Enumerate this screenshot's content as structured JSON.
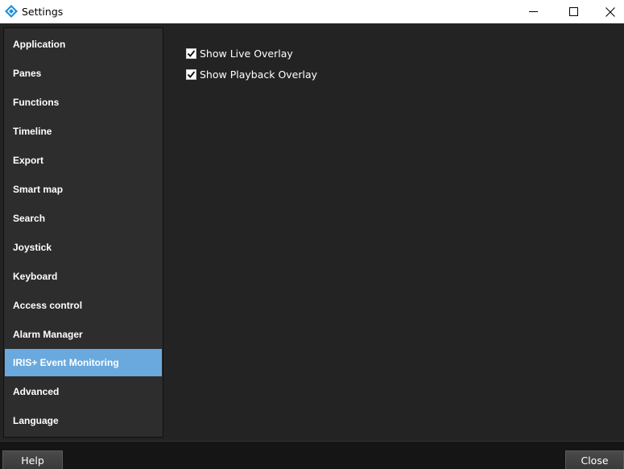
{
  "window": {
    "title": "Settings",
    "icon": "app-logo-icon",
    "controls": [
      "minimize-icon",
      "maximize-icon",
      "close-icon"
    ]
  },
  "sidebar": {
    "items": [
      {
        "label": "Application"
      },
      {
        "label": "Panes"
      },
      {
        "label": "Functions"
      },
      {
        "label": "Timeline"
      },
      {
        "label": "Export"
      },
      {
        "label": "Smart map"
      },
      {
        "label": "Search"
      },
      {
        "label": "Joystick"
      },
      {
        "label": "Keyboard"
      },
      {
        "label": "Access control"
      },
      {
        "label": "Alarm Manager"
      },
      {
        "label": "IRIS+ Event Monitoring"
      },
      {
        "label": "Advanced"
      },
      {
        "label": "Language"
      }
    ],
    "selected": "IRIS+ Event Monitoring",
    "selected_color": "#6aa9dd"
  },
  "main": {
    "options": [
      {
        "label": "Show Live Overlay",
        "checked": true
      },
      {
        "label": "Show Playback Overlay",
        "checked": true
      }
    ]
  },
  "footer": {
    "help_label": "Help",
    "close_label": "Close"
  }
}
